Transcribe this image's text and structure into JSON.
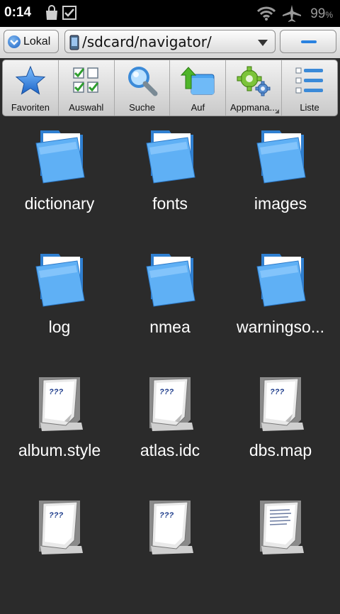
{
  "status": {
    "time": "0:14",
    "battery": "99",
    "battery_unit": "%"
  },
  "location": {
    "storage_label": "Lokal",
    "path": "/sdcard/navigator/"
  },
  "toolbar": {
    "items": [
      {
        "label": "Favoriten",
        "icon": "star-icon"
      },
      {
        "label": "Auswahl",
        "icon": "checklist-icon"
      },
      {
        "label": "Suche",
        "icon": "magnifier-icon"
      },
      {
        "label": "Auf",
        "icon": "up-folder-icon"
      },
      {
        "label": "Appmana...",
        "icon": "gears-icon"
      },
      {
        "label": "Liste",
        "icon": "list-view-icon"
      }
    ]
  },
  "files": [
    {
      "name": "dictionary",
      "type": "folder"
    },
    {
      "name": "fonts",
      "type": "folder"
    },
    {
      "name": "images",
      "type": "folder"
    },
    {
      "name": "log",
      "type": "folder"
    },
    {
      "name": "nmea",
      "type": "folder"
    },
    {
      "name": "warningso...",
      "type": "folder"
    },
    {
      "name": "album.style",
      "type": "unknown-file"
    },
    {
      "name": "atlas.idc",
      "type": "unknown-file"
    },
    {
      "name": "dbs.map",
      "type": "unknown-file"
    },
    {
      "name": "",
      "type": "unknown-file"
    },
    {
      "name": "",
      "type": "unknown-file"
    },
    {
      "name": "",
      "type": "text-file"
    }
  ],
  "colors": {
    "background": "#2b2b2b",
    "accent": "#2a82e0",
    "folder": "#4aa3f0"
  }
}
